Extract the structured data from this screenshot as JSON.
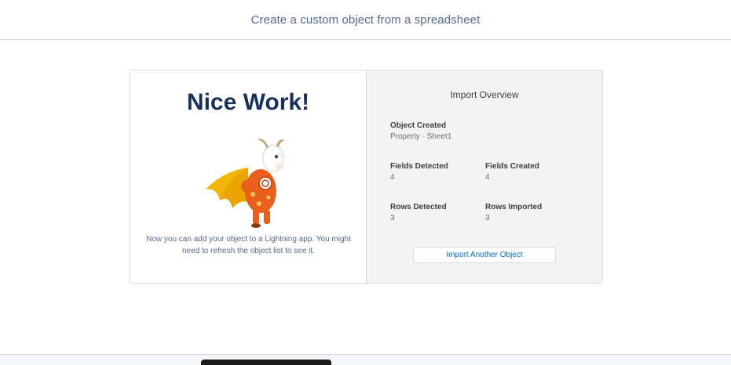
{
  "header": {
    "title": "Create a custom object from a spreadsheet"
  },
  "success": {
    "heading": "Nice Work!",
    "message": "Now you can add your object to a Lightning app. You might need to refresh the object list to see it.",
    "mascot_icon": "goat-superhero-mascot"
  },
  "overview": {
    "title": "Import Overview",
    "object_created": {
      "label": "Object Created",
      "value": "Property · Sheet1"
    },
    "fields_detected": {
      "label": "Fields Detected",
      "value": "4"
    },
    "fields_created": {
      "label": "Fields Created",
      "value": "4"
    },
    "rows_detected": {
      "label": "Rows Detected",
      "value": "3"
    },
    "rows_imported": {
      "label": "Rows Imported",
      "value": "3"
    },
    "import_another_label": "Import Another Object"
  },
  "colors": {
    "heading": "#16325c",
    "link": "#0070d2",
    "panel": "#f3f3f3"
  }
}
